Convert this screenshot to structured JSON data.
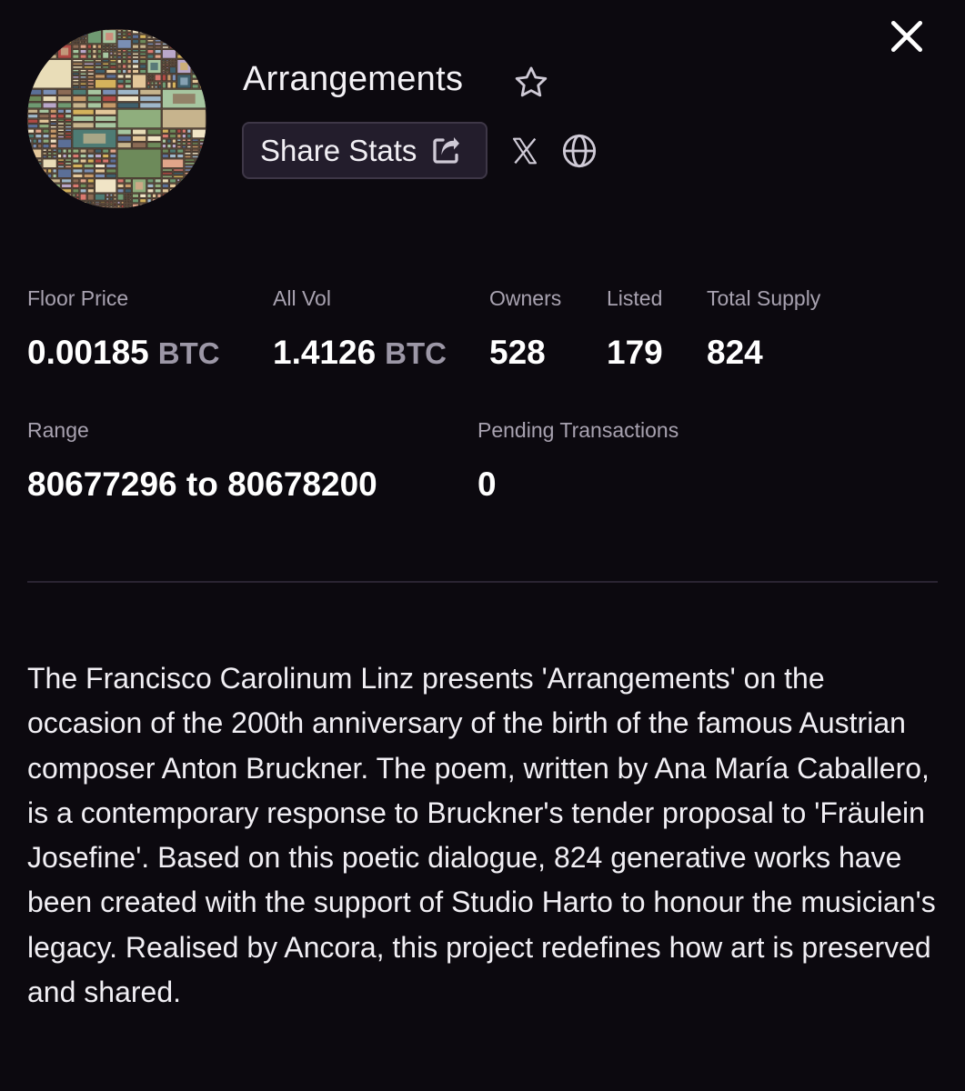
{
  "collection": {
    "title": "Arrangements",
    "share_label": "Share Stats"
  },
  "stats": {
    "floor_price": {
      "label": "Floor Price",
      "value": "0.00185",
      "unit": "BTC"
    },
    "all_vol": {
      "label": "All Vol",
      "value": "1.4126",
      "unit": "BTC"
    },
    "owners": {
      "label": "Owners",
      "value": "528"
    },
    "listed": {
      "label": "Listed",
      "value": "179"
    },
    "total_supply": {
      "label": "Total Supply",
      "value": "824"
    },
    "range": {
      "label": "Range",
      "value": "80677296 to 80678200"
    },
    "pending": {
      "label": "Pending Transactions",
      "value": "0"
    }
  },
  "description": "The Francisco Carolinum Linz presents 'Arrangements' on the occasion of the 200th anniversary of the birth of the famous Austrian composer Anton Bruckner. The poem, written by Ana María Caballero, is a contemporary response to Bruckner's tender proposal to 'Fräulein Josefine'. Based on this poetic dialogue, 824 generative works have been created with the support of Studio Harto to honour the musician's legacy. Realised by Ancora, this project redefines how art is preserved and shared.",
  "icons": {
    "close": "close-icon",
    "favorite": "star-icon",
    "share": "external-share-icon",
    "social": "x-logo-icon",
    "website": "globe-icon"
  },
  "colors": {
    "background": "#0c090f",
    "button_bg": "#231d2c",
    "muted_text": "#a8a2b0",
    "unit_text": "#9c97a6"
  }
}
